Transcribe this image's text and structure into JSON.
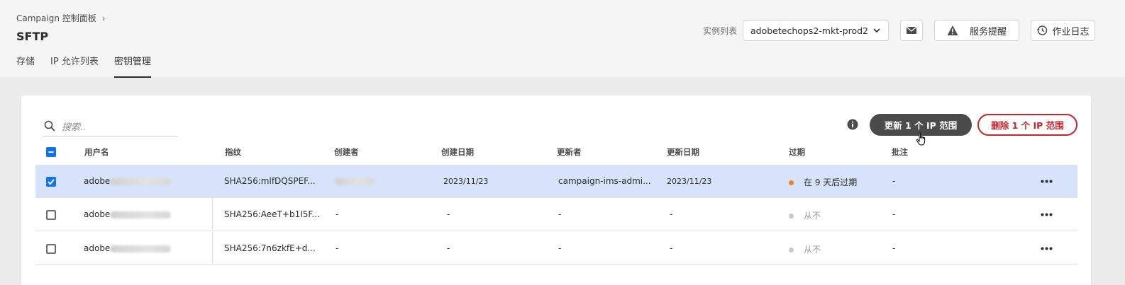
{
  "header": {
    "breadcrumb": "Campaign 控制面板",
    "title": "SFTP",
    "tabs": [
      {
        "label": "存储",
        "selected": false
      },
      {
        "label": "IP 允许列表",
        "selected": false
      },
      {
        "label": "密钥管理",
        "selected": true
      }
    ],
    "instance_label": "实例列表",
    "instance_value": "adobetechops2-mkt-prod2",
    "service_alert_label": "服务提醒",
    "job_log_label": "作业日志"
  },
  "toolbar": {
    "search_placeholder": "搜索..",
    "update_label": "更新 1 个 IP 范围",
    "delete_label": "删除 1 个 IP 范围"
  },
  "table": {
    "columns": [
      "用户名",
      "指纹",
      "创建者",
      "创建日期",
      "更新者",
      "更新日期",
      "过期",
      "批注"
    ],
    "rows": [
      {
        "selected": true,
        "username": "adobe",
        "fingerprint": "SHA256:mlfDQSPEF...",
        "created_by": "",
        "created_date": "2023/11/23",
        "updated_by": "campaign-ims-admi...",
        "updated_date": "2023/11/23",
        "expiry": "在 9 天后过期",
        "expiry_status": "warning",
        "notes": "-"
      },
      {
        "selected": false,
        "username": "adobe",
        "fingerprint": "SHA256:AeeT+b1I5F...",
        "created_by": "-",
        "created_date": "-",
        "updated_by": "-",
        "updated_date": "-",
        "expiry": "从不",
        "expiry_status": "never",
        "notes": "-"
      },
      {
        "selected": false,
        "username": "adobe",
        "fingerprint": "SHA256:7n6zkfE+d...",
        "created_by": "-",
        "created_date": "-",
        "updated_by": "-",
        "updated_date": "-",
        "expiry": "从不",
        "expiry_status": "never",
        "notes": "-"
      }
    ]
  },
  "colors": {
    "accent_blue": "#1473e6",
    "selected_row": "#d6e3fa",
    "warning_dot": "#e68619",
    "never_dot": "#cacaca",
    "delete_red": "#c9252d",
    "update_dark": "#4b4b4b"
  },
  "icons": [
    "chevron-right-icon",
    "chevron-down-icon",
    "mail-icon",
    "alert-icon",
    "history-icon",
    "search-icon",
    "info-icon",
    "hand-cursor-icon",
    "more-icon",
    "checkbox-check-icon"
  ]
}
